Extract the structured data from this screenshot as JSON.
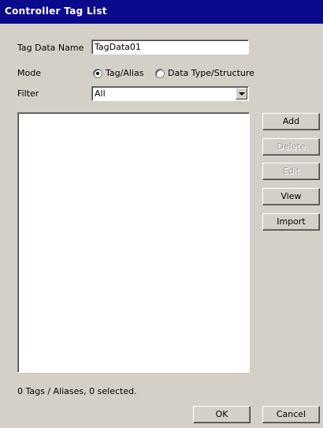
{
  "window": {
    "title": "Controller Tag List"
  },
  "form": {
    "tag_data_name_label": "Tag Data Name",
    "tag_data_name_value": "TagData01",
    "mode_label": "Mode",
    "mode_options": [
      {
        "label": "Tag/Alias",
        "selected": true
      },
      {
        "label": "Data Type/Structure",
        "selected": false
      }
    ],
    "filter_label": "Filter",
    "filter_value": "All"
  },
  "side_buttons": [
    {
      "label": "Add",
      "enabled": true
    },
    {
      "label": "Delete",
      "enabled": false
    },
    {
      "label": "Edit",
      "enabled": false
    },
    {
      "label": "View",
      "enabled": true
    },
    {
      "label": "Import",
      "enabled": true
    }
  ],
  "status": {
    "text": "0 Tags / Aliases, 0 selected."
  },
  "footer": {
    "ok_label": "OK",
    "cancel_label": "Cancel"
  }
}
